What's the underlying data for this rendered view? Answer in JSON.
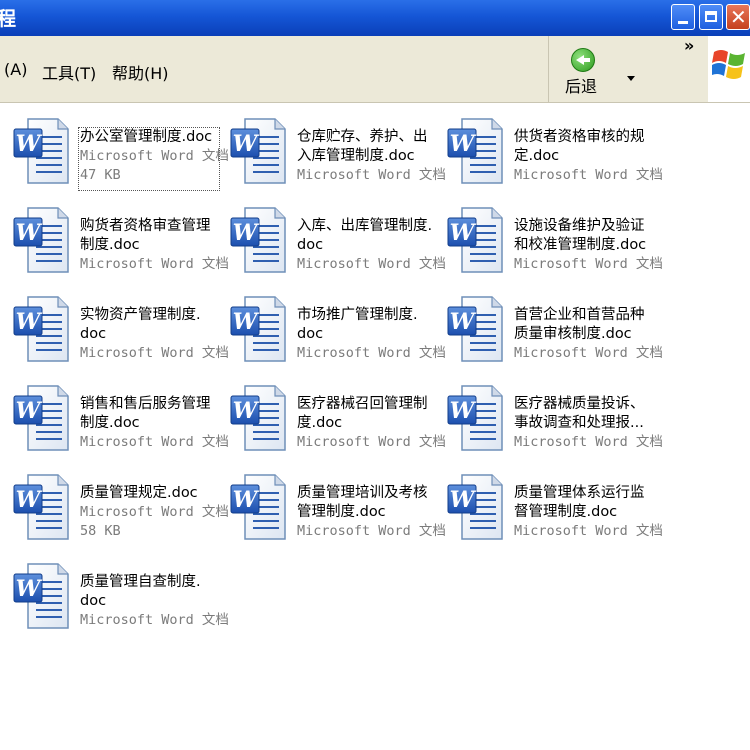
{
  "window": {
    "title": "程"
  },
  "menu": {
    "items": [
      {
        "label": "(A)"
      },
      {
        "label": "工具(T)"
      },
      {
        "label": "帮助(H)"
      }
    ]
  },
  "toolbar": {
    "back_label": "后退",
    "chevrons": "»"
  },
  "files": [
    {
      "name_lines": [
        "办公室管理制度.doc"
      ],
      "type": "Microsoft Word 文档",
      "size": "47 KB",
      "selected": true
    },
    {
      "name_lines": [
        "仓库贮存、养护、出",
        "入库管理制度.doc"
      ],
      "type": "Microsoft Word 文档",
      "size": ""
    },
    {
      "name_lines": [
        "供货者资格审核的规",
        "定.doc"
      ],
      "type": "Microsoft Word 文档",
      "size": ""
    },
    {
      "name_lines": [
        "购货者资格审查管理",
        "制度.doc"
      ],
      "type": "Microsoft Word 文档",
      "size": ""
    },
    {
      "name_lines": [
        "入库、出库管理制度.",
        "doc"
      ],
      "type": "Microsoft Word 文档",
      "size": ""
    },
    {
      "name_lines": [
        "设施设备维护及验证",
        "和校准管理制度.doc"
      ],
      "type": "Microsoft Word 文档",
      "size": ""
    },
    {
      "name_lines": [
        "实物资产管理制度.",
        "doc"
      ],
      "type": "Microsoft Word 文档",
      "size": ""
    },
    {
      "name_lines": [
        "市场推广管理制度.",
        "doc"
      ],
      "type": "Microsoft Word 文档",
      "size": ""
    },
    {
      "name_lines": [
        "首营企业和首营品种",
        "质量审核制度.doc"
      ],
      "type": "Microsoft Word 文档",
      "size": ""
    },
    {
      "name_lines": [
        "销售和售后服务管理",
        "制度.doc"
      ],
      "type": "Microsoft Word 文档",
      "size": ""
    },
    {
      "name_lines": [
        "医疗器械召回管理制",
        "度.doc"
      ],
      "type": "Microsoft Word 文档",
      "size": ""
    },
    {
      "name_lines": [
        "医疗器械质量投诉、",
        "事故调查和处理报..."
      ],
      "type": "Microsoft Word 文档",
      "size": ""
    },
    {
      "name_lines": [
        "质量管理规定.doc"
      ],
      "type": "Microsoft Word 文档",
      "size": "58 KB"
    },
    {
      "name_lines": [
        "质量管理培训及考核",
        "管理制度.doc"
      ],
      "type": "Microsoft Word 文档",
      "size": ""
    },
    {
      "name_lines": [
        "质量管理体系运行监",
        "督管理制度.doc"
      ],
      "type": "Microsoft Word 文档",
      "size": ""
    },
    {
      "name_lines": [
        "质量管理自查制度.",
        "doc"
      ],
      "type": "Microsoft Word 文档",
      "size": ""
    }
  ]
}
